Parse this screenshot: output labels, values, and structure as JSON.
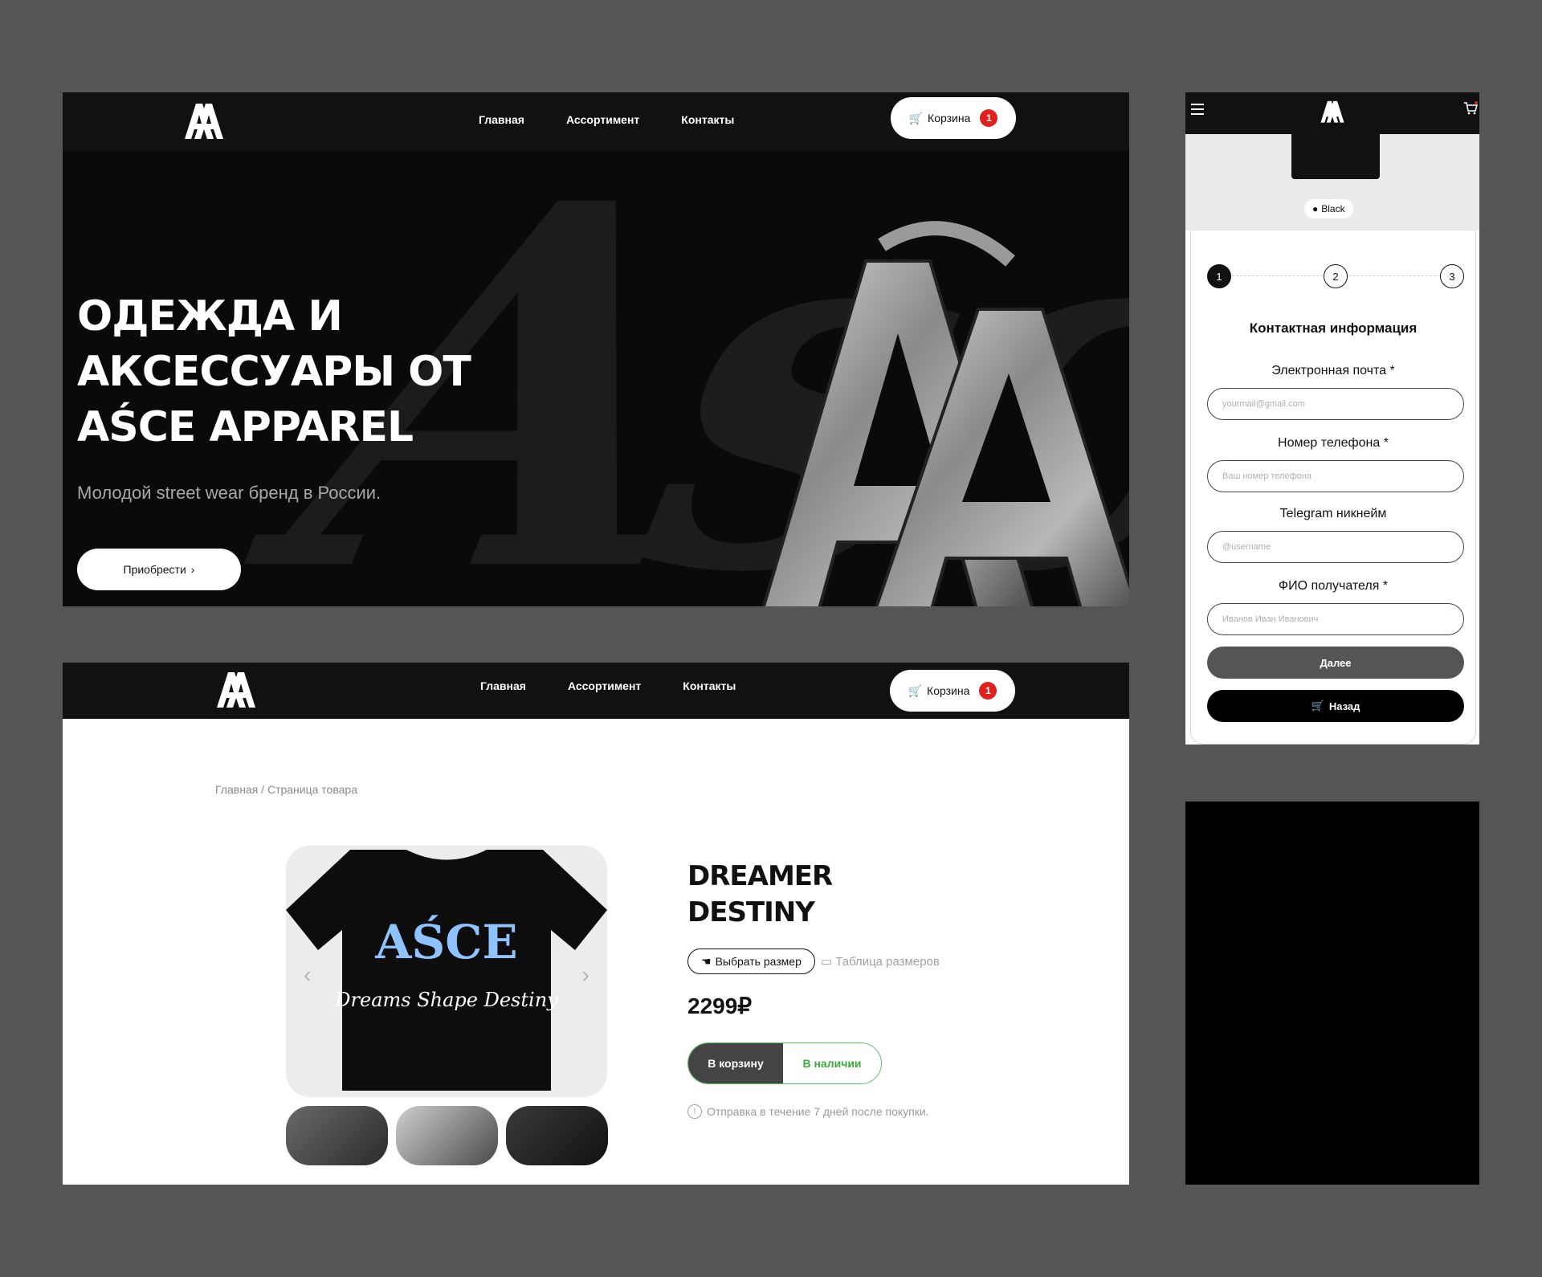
{
  "brand": {
    "logo_text": "AA"
  },
  "nav": {
    "links": [
      "Главная",
      "Ассортимент",
      "Контакты"
    ],
    "cart_label": "Корзина",
    "cart_count": "1"
  },
  "hero": {
    "background_script": "Asce",
    "title": "ОДЕЖДА И АКСЕССУАРЫ ОТ AŚCE APPAREL",
    "subtitle": "Молодой street wear бренд в России.",
    "cta_label": "Приобрести"
  },
  "product": {
    "breadcrumb": "Главная / Страница товара",
    "title": "DREAMER DESTINY",
    "size_button": "Выбрать размер",
    "size_table": "Таблица размеров",
    "price": "2299₽",
    "add_to_cart": "В корзину",
    "stock_status": "В наличии",
    "shipping_note": "Отправка в течение 7 дней после покупки.",
    "shirt_print_logo": "AŚCE",
    "shirt_print_text": "Dreams Shape Destiny"
  },
  "mobile": {
    "color_label": "Black",
    "steps": [
      "1",
      "2",
      "3"
    ],
    "heading": "Контактная информация",
    "fields": [
      {
        "label": "Электронная почта *",
        "placeholder": "yourmail@gmail.com"
      },
      {
        "label": "Номер телефона *",
        "placeholder": "Ваш номер телефона"
      },
      {
        "label": "Telegram никнейм",
        "placeholder": "@username"
      },
      {
        "label": "ФИО получателя *",
        "placeholder": "Иванов Иван Иванович"
      }
    ],
    "next_label": "Далее",
    "back_label": "Назад"
  },
  "colors": {
    "page_bg": "#555555",
    "accent_red": "#e0201c",
    "stock_green": "#3cab3c"
  }
}
